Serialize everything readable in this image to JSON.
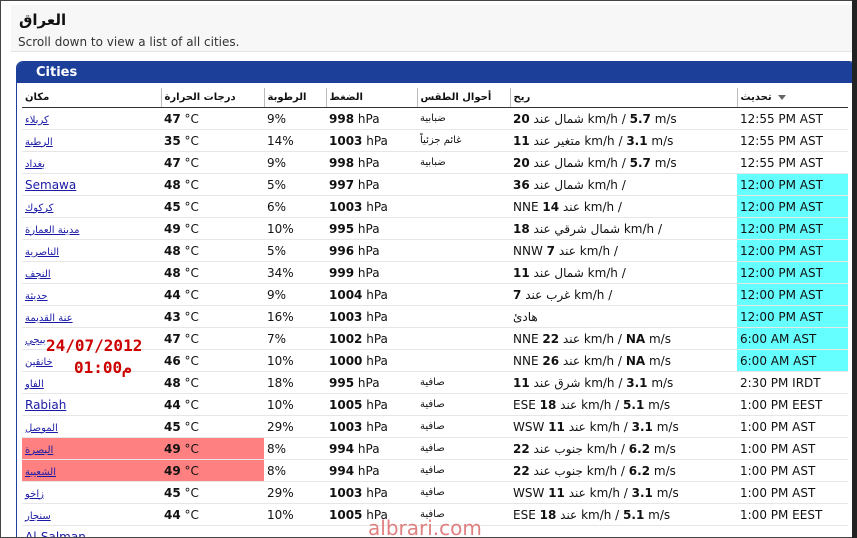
{
  "page": {
    "title": "العراق",
    "subtitle": "Scroll down to view a list of all cities."
  },
  "cities_panel": {
    "title": "Cities",
    "headers": {
      "city": "مكان",
      "temp": "درجات الحرارة",
      "humidity": "الرطوبة",
      "pressure": "الضغط",
      "conditions": "أحوال الطقس",
      "wind": "ريح",
      "updated": "تحديث"
    },
    "rows": [
      {
        "city": "كربلاء",
        "latin": false,
        "temp": "47",
        "hum": "9%",
        "press": "998",
        "cond": "ضبابية",
        "wind_pre": "",
        "wind_num": "20",
        "wind_dir": "شمال عند",
        "wind_kmh": "km/h /",
        "wind_ms": "5.7",
        "wind_ms_unit": "m/s",
        "updated": "12:55 PM AST",
        "hl": ""
      },
      {
        "city": "الرطبة",
        "latin": false,
        "temp": "35",
        "hum": "14%",
        "press": "1003",
        "cond": "غائم جزئياً",
        "wind_pre": "",
        "wind_num": "11",
        "wind_dir": "متغير عند",
        "wind_kmh": "km/h /",
        "wind_ms": "3.1",
        "wind_ms_unit": "m/s",
        "updated": "12:55 PM AST",
        "hl": ""
      },
      {
        "city": "بغداد",
        "latin": false,
        "temp": "47",
        "hum": "9%",
        "press": "998",
        "cond": "ضبابية",
        "wind_pre": "",
        "wind_num": "20",
        "wind_dir": "شمال عند",
        "wind_kmh": "km/h /",
        "wind_ms": "5.7",
        "wind_ms_unit": "m/s",
        "updated": "12:55 PM AST",
        "hl": ""
      },
      {
        "city": "Semawa",
        "latin": true,
        "temp": "48",
        "hum": "5%",
        "press": "997",
        "cond": "",
        "wind_pre": "",
        "wind_num": "36",
        "wind_dir": "شمال عند",
        "wind_kmh": "km/h /",
        "wind_ms": "",
        "wind_ms_unit": "",
        "updated": "12:00 PM AST",
        "hl": "cyan"
      },
      {
        "city": "كركوك",
        "latin": false,
        "temp": "45",
        "hum": "6%",
        "press": "1003",
        "cond": "",
        "wind_pre": "NNE",
        "wind_num": "14",
        "wind_dir": "عند",
        "wind_kmh": "km/h /",
        "wind_ms": "",
        "wind_ms_unit": "",
        "updated": "12:00 PM AST",
        "hl": "cyan"
      },
      {
        "city": "مدينة العمارة",
        "latin": false,
        "temp": "49",
        "hum": "10%",
        "press": "995",
        "cond": "",
        "wind_pre": "",
        "wind_num": "18",
        "wind_dir": "شمال شرقي عند",
        "wind_kmh": "km/h /",
        "wind_ms": "",
        "wind_ms_unit": "",
        "updated": "12:00 PM AST",
        "hl": "cyan"
      },
      {
        "city": "الناصرية",
        "latin": false,
        "temp": "48",
        "hum": "5%",
        "press": "996",
        "cond": "",
        "wind_pre": "NNW",
        "wind_num": "7",
        "wind_dir": "عند",
        "wind_kmh": "km/h /",
        "wind_ms": "",
        "wind_ms_unit": "",
        "updated": "12:00 PM AST",
        "hl": "cyan"
      },
      {
        "city": "النجف",
        "latin": false,
        "temp": "48",
        "hum": "34%",
        "press": "999",
        "cond": "",
        "wind_pre": "",
        "wind_num": "11",
        "wind_dir": "شمال عند",
        "wind_kmh": "km/h /",
        "wind_ms": "",
        "wind_ms_unit": "",
        "updated": "12:00 PM AST",
        "hl": "cyan"
      },
      {
        "city": "حديثة",
        "latin": false,
        "temp": "44",
        "hum": "9%",
        "press": "1004",
        "cond": "",
        "wind_pre": "",
        "wind_num": "7",
        "wind_dir": "غرب عند",
        "wind_kmh": "km/h /",
        "wind_ms": "",
        "wind_ms_unit": "",
        "updated": "12:00 PM AST",
        "hl": "cyan"
      },
      {
        "city": "عنة القديمة",
        "latin": false,
        "temp": "43",
        "hum": "16%",
        "press": "1003",
        "cond": "",
        "wind_pre": "",
        "wind_num": "",
        "wind_dir": "هادئ",
        "wind_kmh": "",
        "wind_ms": "",
        "wind_ms_unit": "",
        "updated": "12:00 PM AST",
        "hl": "cyan"
      },
      {
        "city": "بيجي",
        "latin": false,
        "temp": "47",
        "hum": "7%",
        "press": "1002",
        "cond": "",
        "wind_pre": "NNE",
        "wind_num": "22",
        "wind_dir": "عند",
        "wind_kmh": "km/h /",
        "wind_ms": "NA",
        "wind_ms_unit": "m/s",
        "updated": "6:00 AM AST",
        "hl": "cyan"
      },
      {
        "city": "خانقين",
        "latin": false,
        "temp": "46",
        "hum": "10%",
        "press": "1000",
        "cond": "",
        "wind_pre": "NNE",
        "wind_num": "26",
        "wind_dir": "عند",
        "wind_kmh": "km/h /",
        "wind_ms": "NA",
        "wind_ms_unit": "m/s",
        "updated": "6:00 AM AST",
        "hl": "cyan"
      },
      {
        "city": "الفاو",
        "latin": false,
        "temp": "48",
        "hum": "18%",
        "press": "995",
        "cond": "صافية",
        "wind_pre": "",
        "wind_num": "11",
        "wind_dir": "شرق عند",
        "wind_kmh": "km/h /",
        "wind_ms": "3.1",
        "wind_ms_unit": "m/s",
        "updated": "2:30 PM IRDT",
        "hl": ""
      },
      {
        "city": "Rabiah",
        "latin": true,
        "temp": "44",
        "hum": "10%",
        "press": "1005",
        "cond": "صافية",
        "wind_pre": "ESE",
        "wind_num": "18",
        "wind_dir": "عند",
        "wind_kmh": "km/h /",
        "wind_ms": "5.1",
        "wind_ms_unit": "m/s",
        "updated": "1:00 PM EEST",
        "hl": ""
      },
      {
        "city": "الموصل",
        "latin": false,
        "temp": "45",
        "hum": "29%",
        "press": "1003",
        "cond": "صافية",
        "wind_pre": "WSW",
        "wind_num": "11",
        "wind_dir": "عند",
        "wind_kmh": "km/h /",
        "wind_ms": "3.1",
        "wind_ms_unit": "m/s",
        "updated": "1:00 PM AST",
        "hl": ""
      },
      {
        "city": "البصرة",
        "latin": false,
        "temp": "49",
        "hum": "8%",
        "press": "994",
        "cond": "صافية",
        "wind_pre": "",
        "wind_num": "22",
        "wind_dir": "جنوب عند",
        "wind_kmh": "km/h /",
        "wind_ms": "6.2",
        "wind_ms_unit": "m/s",
        "updated": "1:00 PM AST",
        "hl": "red"
      },
      {
        "city": "الشعيبة",
        "latin": false,
        "temp": "49",
        "hum": "8%",
        "press": "994",
        "cond": "صافية",
        "wind_pre": "",
        "wind_num": "22",
        "wind_dir": "جنوب عند",
        "wind_kmh": "km/h /",
        "wind_ms": "6.2",
        "wind_ms_unit": "m/s",
        "updated": "1:00 PM AST",
        "hl": "red"
      },
      {
        "city": "زاخو",
        "latin": false,
        "temp": "45",
        "hum": "29%",
        "press": "1003",
        "cond": "صافية",
        "wind_pre": "WSW",
        "wind_num": "11",
        "wind_dir": "عند",
        "wind_kmh": "km/h /",
        "wind_ms": "3.1",
        "wind_ms_unit": "m/s",
        "updated": "1:00 PM AST",
        "hl": ""
      },
      {
        "city": "سنجار",
        "latin": false,
        "temp": "44",
        "hum": "10%",
        "press": "1005",
        "cond": "صافية",
        "wind_pre": "ESE",
        "wind_num": "18",
        "wind_dir": "عند",
        "wind_kmh": "km/h /",
        "wind_ms": "5.1",
        "wind_ms_unit": "m/s",
        "updated": "1:00 PM EEST",
        "hl": ""
      },
      {
        "city": "Al-Salman",
        "latin": true,
        "temp": "",
        "hum": "",
        "press": "",
        "cond": "",
        "wind_pre": "",
        "wind_num": "",
        "wind_dir": "",
        "wind_kmh": "",
        "wind_ms": "",
        "wind_ms_unit": "",
        "updated": "",
        "hl": ""
      }
    ],
    "units": {
      "temp": "°C",
      "pressure": "hPa"
    }
  },
  "overlay": {
    "date": "24/07/2012",
    "time": "01:00",
    "time_suffix": "م",
    "watermark": "albrari.com"
  },
  "colors": {
    "accent": "#1c3f9a",
    "highlight_cyan": "#66ffff",
    "highlight_red": "#ff8080",
    "link": "#1a1aa6",
    "stamp": "#cc0000"
  }
}
